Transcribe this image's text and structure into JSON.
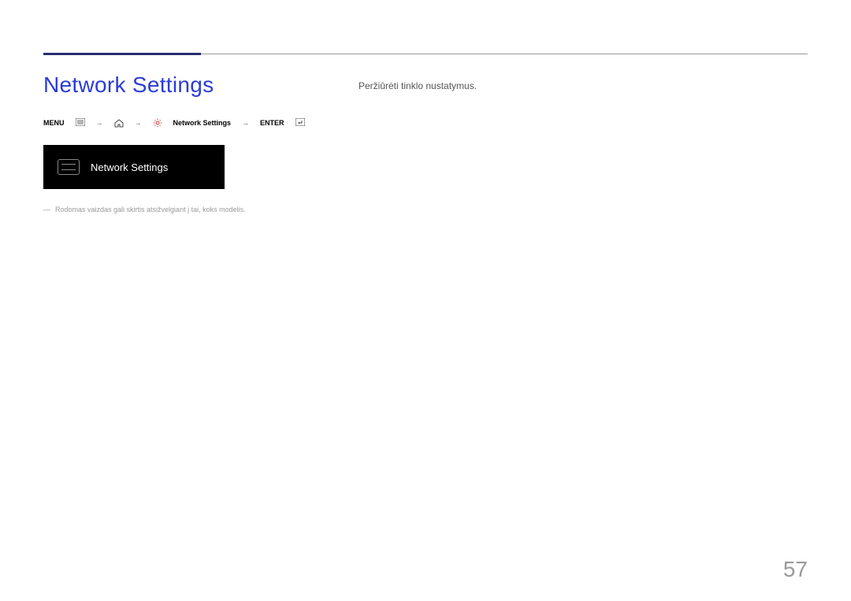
{
  "heading": "Network Settings",
  "breadcrumb": {
    "menu_label": "MENU",
    "trail_label": "Network Settings",
    "enter_label": "ENTER"
  },
  "preview_panel": {
    "title": "Network Settings"
  },
  "note": "Rodomas vaizdas gali skirtis atsižvelgiant į tai, koks modelis.",
  "body": "Peržiūrėti tinklo nustatymus.",
  "page_number": "57"
}
